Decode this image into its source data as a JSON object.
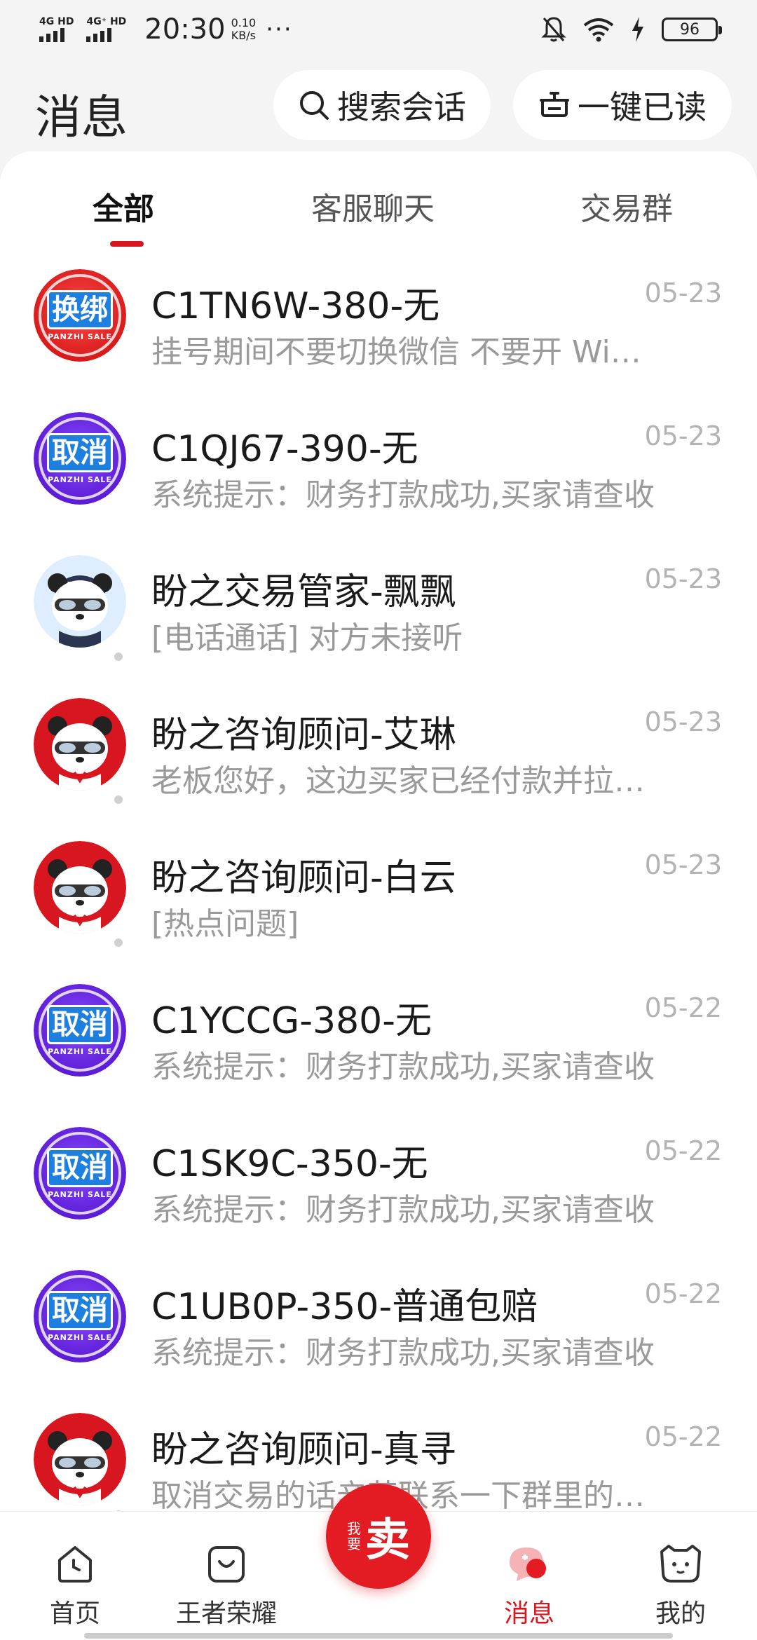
{
  "status_bar": {
    "sim1": "4G HD",
    "sim2": "4G⁺ HD",
    "time": "20:30",
    "speed_value": "0.10",
    "speed_unit": "KB/s",
    "more": "···",
    "battery": "96"
  },
  "header": {
    "title": "消息",
    "search_label": "搜索会话",
    "mark_read_label": "一键已读"
  },
  "tabs": [
    {
      "label": "全部",
      "active": true
    },
    {
      "label": "客服聊天",
      "active": false
    },
    {
      "label": "交易群",
      "active": false
    }
  ],
  "conversations": [
    {
      "avatar": "badge",
      "badge_text": "换绑",
      "badge_color": "red",
      "title": "C1TN6W-380-无",
      "preview": "挂号期间不要切换微信 不要开 Wi…",
      "date": "05-23"
    },
    {
      "avatar": "badge",
      "badge_text": "取消",
      "badge_color": "purple",
      "title": "C1QJ67-390-无",
      "preview": "系统提示：财务打款成功,买家请查收",
      "date": "05-23"
    },
    {
      "avatar": "panda",
      "panda_bg": "blue",
      "title": "盼之交易管家-飘飘",
      "preview": "[电话通话] 对方未接听",
      "date": "05-23"
    },
    {
      "avatar": "panda",
      "panda_bg": "red",
      "title": "盼之咨询顾问-艾琳",
      "preview": "老板您好，这边买家已经付款并拉…",
      "date": "05-23"
    },
    {
      "avatar": "panda",
      "panda_bg": "red",
      "title": "盼之咨询顾问-白云",
      "preview": "[热点问题]",
      "date": "05-23"
    },
    {
      "avatar": "badge",
      "badge_text": "取消",
      "badge_color": "purple",
      "title": "C1YCCG-380-无",
      "preview": "系统提示：财务打款成功,买家请查收",
      "date": "05-22"
    },
    {
      "avatar": "badge",
      "badge_text": "取消",
      "badge_color": "purple",
      "title": "C1SK9C-350-无",
      "preview": "系统提示：财务打款成功,买家请查收",
      "date": "05-22"
    },
    {
      "avatar": "badge",
      "badge_text": "取消",
      "badge_color": "purple",
      "title": "C1UB0P-350-普通包赔",
      "preview": "系统提示：财务打款成功,买家请查收",
      "date": "05-22"
    },
    {
      "avatar": "panda",
      "panda_bg": "red",
      "title": "盼之咨询顾问-真寻",
      "preview": "取消交易的话辛苦联系一下群里的…",
      "date": "05-22"
    }
  ],
  "badge_subtext": "PANZHI SALE",
  "bottom_nav": {
    "home": "首页",
    "game": "王者荣耀",
    "sell_small": "我要",
    "sell_big": "卖",
    "messages": "消息",
    "mine": "我的"
  },
  "colors": {
    "accent": "#d8161f",
    "badge_red": "#d91a1a",
    "badge_purple": "#5d1cd6",
    "badge_word_bg": "#1d7fe0"
  }
}
